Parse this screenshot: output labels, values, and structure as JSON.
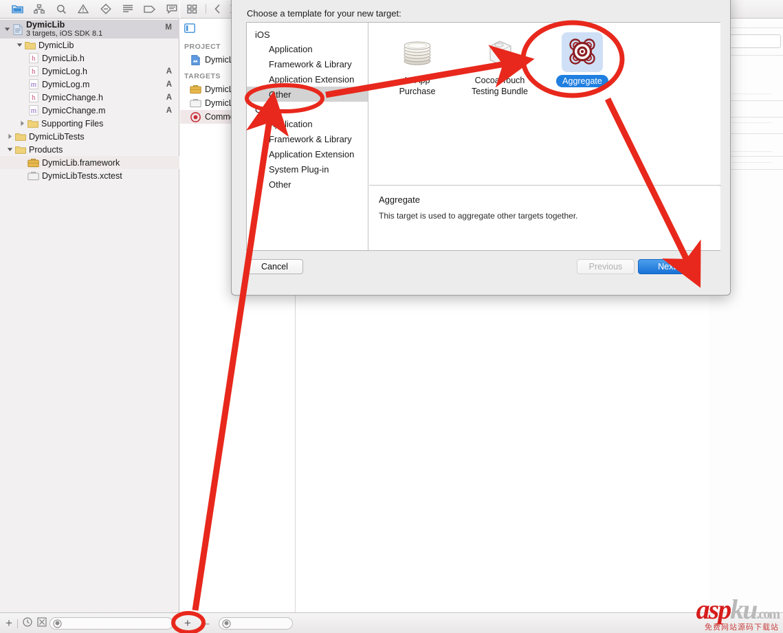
{
  "navigator": {
    "toolbar_icons": [
      "folder-icon",
      "hierarchy-icon",
      "search-icon",
      "warning-triangle-icon",
      "diamond-minus-icon",
      "list-icon",
      "tag-icon",
      "speech-bubble-icon"
    ],
    "project_header": {
      "title": "DymicLib",
      "subtitle": "3 targets, iOS SDK 8.1",
      "status": "M"
    },
    "tree": [
      {
        "label": "DymicLib",
        "icon": "folder-icon",
        "indent": 1,
        "disclosure": "open",
        "status": ""
      },
      {
        "label": "DymicLib.h",
        "icon": "header-file-icon",
        "indent": 2,
        "disclosure": "none",
        "status": ""
      },
      {
        "label": "DymicLog.h",
        "icon": "header-file-icon",
        "indent": 2,
        "disclosure": "none",
        "status": "A"
      },
      {
        "label": "DymicLog.m",
        "icon": "method-file-icon",
        "indent": 2,
        "disclosure": "none",
        "status": "A"
      },
      {
        "label": "DymicChange.h",
        "icon": "header-file-icon",
        "indent": 2,
        "disclosure": "none",
        "status": "A"
      },
      {
        "label": "DymicChange.m",
        "icon": "method-file-icon",
        "indent": 2,
        "disclosure": "none",
        "status": "A"
      },
      {
        "label": "Supporting Files",
        "icon": "folder-icon",
        "indent": 2,
        "disclosure": "closed",
        "status": ""
      },
      {
        "label": "DymicLibTests",
        "icon": "folder-icon",
        "indent": 1,
        "disclosure": "closed",
        "status": ""
      },
      {
        "label": "Products",
        "icon": "folder-icon",
        "indent": 1,
        "disclosure": "open",
        "status": ""
      },
      {
        "label": "DymicLib.framework",
        "icon": "framework-icon",
        "indent": 2,
        "disclosure": "none",
        "status": "",
        "selected": true
      },
      {
        "label": "DymicLibTests.xctest",
        "icon": "xctest-icon",
        "indent": 2,
        "disclosure": "none",
        "status": ""
      }
    ]
  },
  "project_panel": {
    "project_section_label": "PROJECT",
    "targets_section_label": "TARGETS",
    "project_items": [
      {
        "label": "DymicLi",
        "icon": "xcode-project-icon"
      }
    ],
    "target_items": [
      {
        "label": "DymicLi",
        "icon": "framework-target-icon",
        "selected": false
      },
      {
        "label": "DymicLi",
        "icon": "xctest-target-icon",
        "selected": false
      },
      {
        "label": "Commo",
        "icon": "aggregate-target-icon",
        "selected": true
      }
    ]
  },
  "sheet": {
    "title": "Choose a template for your new target:",
    "categories": [
      {
        "label": "iOS",
        "type": "group"
      },
      {
        "label": "Application",
        "type": "item"
      },
      {
        "label": "Framework & Library",
        "type": "item"
      },
      {
        "label": "Application Extension",
        "type": "item"
      },
      {
        "label": "Other",
        "type": "item",
        "selected": true
      },
      {
        "label": "OS X",
        "type": "group"
      },
      {
        "label": "Application",
        "type": "item"
      },
      {
        "label": "Framework & Library",
        "type": "item"
      },
      {
        "label": "Application Extension",
        "type": "item"
      },
      {
        "label": "System Plug-in",
        "type": "item"
      },
      {
        "label": "Other",
        "type": "item"
      }
    ],
    "templates": [
      {
        "name": "In-App\nPurchase",
        "icon": "coin-stack-icon",
        "selected": false
      },
      {
        "name": "Cocoa Touch\nTesting Bundle",
        "icon": "cocoa-touch-test-icon",
        "selected": false
      },
      {
        "name": "Aggregate",
        "icon": "aggregate-target-icon",
        "selected": true
      }
    ],
    "description": {
      "title": "Aggregate",
      "body": "This target is used to aggregate other targets together."
    },
    "buttons": {
      "cancel": "Cancel",
      "previous": "Previous",
      "next": "Next"
    }
  },
  "statusbar": {
    "add_label": "+",
    "remove_label": "–",
    "icons": [
      "plus-icon",
      "clock-icon",
      "breakpoint-icon"
    ]
  },
  "watermark": {
    "brand_red": "asp",
    "brand_gray": "ku",
    "domain": ".com",
    "subtitle": "免费网站源码下载站"
  },
  "colors": {
    "annotation_red": "#e8281c",
    "accent_blue": "#1f7fe0",
    "selection_gray": "#d3d3d3",
    "sheet_bg": "#ececec"
  }
}
